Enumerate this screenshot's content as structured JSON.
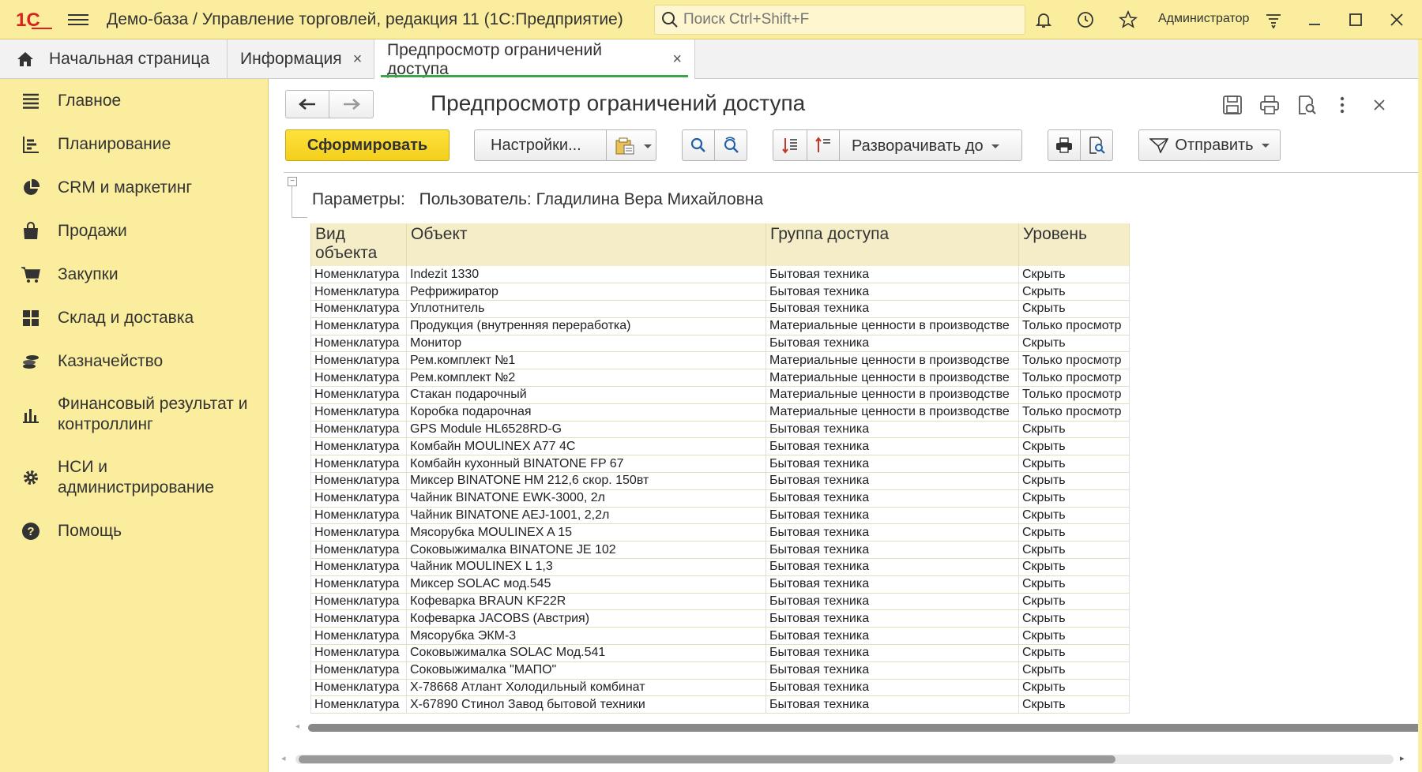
{
  "titlebar": {
    "logo_text": "1С",
    "title": "Демо-база / Управление торговлей, редакция 11  (1С:Предприятие)",
    "search_placeholder": "Поиск Ctrl+Shift+F",
    "user": "Администратор"
  },
  "tabs": [
    {
      "label": "Начальная страница"
    },
    {
      "label": "Информация"
    },
    {
      "label": "Предпросмотр ограничений доступа"
    }
  ],
  "sidebar": {
    "items": [
      {
        "label": "Главное",
        "icon": "menu-lines-icon"
      },
      {
        "label": "Планирование",
        "icon": "planning-icon"
      },
      {
        "label": "CRM и маркетинг",
        "icon": "pie-chart-icon"
      },
      {
        "label": "Продажи",
        "icon": "shopping-bag-icon"
      },
      {
        "label": "Закупки",
        "icon": "cart-icon"
      },
      {
        "label": "Склад и доставка",
        "icon": "warehouse-icon"
      },
      {
        "label": "Казначейство",
        "icon": "coins-icon"
      },
      {
        "label": "Финансовый результат и контроллинг",
        "icon": "bar-chart-icon"
      },
      {
        "label": "НСИ и администрирование",
        "icon": "gear-icon"
      },
      {
        "label": "Помощь",
        "icon": "help-icon"
      }
    ]
  },
  "form": {
    "title": "Предпросмотр ограничений доступа",
    "generate_label": "Сформировать",
    "settings_label": "Настройки...",
    "expand_label": "Разворачивать до",
    "send_label": "Отправить"
  },
  "report": {
    "params_label": "Параметры:",
    "params_value": "Пользователь: Гладилина Вера Михайловна",
    "columns": [
      "Вид объекта",
      "Объект",
      "Группа доступа",
      "Уровень"
    ],
    "rows": [
      [
        "Номенклатура",
        "Indezit 1330",
        "Бытовая техника",
        "Скрыть"
      ],
      [
        "Номенклатура",
        "Рефрижиратор",
        "Бытовая техника",
        "Скрыть"
      ],
      [
        "Номенклатура",
        "Уплотнитель",
        "Бытовая техника",
        "Скрыть"
      ],
      [
        "Номенклатура",
        "Продукция (внутренняя переработка)",
        "Материальные ценности в производстве",
        "Только просмотр"
      ],
      [
        "Номенклатура",
        "Монитор",
        "Бытовая техника",
        "Скрыть"
      ],
      [
        "Номенклатура",
        "Рем.комплект №1",
        "Материальные ценности в производстве",
        "Только просмотр"
      ],
      [
        "Номенклатура",
        "Рем.комплект №2",
        "Материальные ценности в производстве",
        "Только просмотр"
      ],
      [
        "Номенклатура",
        "Стакан подарочный",
        "Материальные ценности в производстве",
        "Только просмотр"
      ],
      [
        "Номенклатура",
        "Коробка подарочная",
        "Материальные ценности в производстве",
        "Только просмотр"
      ],
      [
        "Номенклатура",
        "GPS Module HL6528RD-G",
        "Бытовая техника",
        "Скрыть"
      ],
      [
        "Номенклатура",
        "Комбайн MOULINEX  A77 4C",
        "Бытовая техника",
        "Скрыть"
      ],
      [
        "Номенклатура",
        "Комбайн кухонный BINATONE FP 67",
        "Бытовая техника",
        "Скрыть"
      ],
      [
        "Номенклатура",
        "Миксер BINATONE HM 212,6 скор. 150вт",
        "Бытовая техника",
        "Скрыть"
      ],
      [
        "Номенклатура",
        "Чайник BINATONE  EWK-3000,  2л",
        "Бытовая техника",
        "Скрыть"
      ],
      [
        "Номенклатура",
        "Чайник BINATONE  AEJ-1001,  2,2л",
        "Бытовая техника",
        "Скрыть"
      ],
      [
        "Номенклатура",
        "Мясорубка MOULINEX  A 15",
        "Бытовая техника",
        "Скрыть"
      ],
      [
        "Номенклатура",
        "Соковыжималка  BINATONE JE 102",
        "Бытовая техника",
        "Скрыть"
      ],
      [
        "Номенклатура",
        "Чайник MOULINEX L 1,3",
        "Бытовая техника",
        "Скрыть"
      ],
      [
        "Номенклатура",
        "Миксер SOLAC мод.545",
        "Бытовая техника",
        "Скрыть"
      ],
      [
        "Номенклатура",
        "Кофеварка BRAUN KF22R",
        "Бытовая техника",
        "Скрыть"
      ],
      [
        "Номенклатура",
        "Кофеварка JACOBS (Австрия)",
        "Бытовая техника",
        "Скрыть"
      ],
      [
        "Номенклатура",
        "Мясорубка ЭКМ-3",
        "Бытовая техника",
        "Скрыть"
      ],
      [
        "Номенклатура",
        "Соковыжималка  SOLAC  Мод.541",
        "Бытовая техника",
        "Скрыть"
      ],
      [
        "Номенклатура",
        "Соковыжималка \"МАПО\"",
        "Бытовая техника",
        "Скрыть"
      ],
      [
        "Номенклатура",
        "Х-78668 Атлант Холодильный комбинат",
        "Бытовая техника",
        "Скрыть"
      ],
      [
        "Номенклатура",
        "Х-67890 Стинол Завод бытовой техники",
        "Бытовая техника",
        "Скрыть"
      ]
    ]
  },
  "colors": {
    "accent_yellow": "#fbed9e",
    "button_yellow": "#f4cf1c",
    "active_tab_underline": "#3aa64a",
    "logo_red": "#d8231e"
  }
}
